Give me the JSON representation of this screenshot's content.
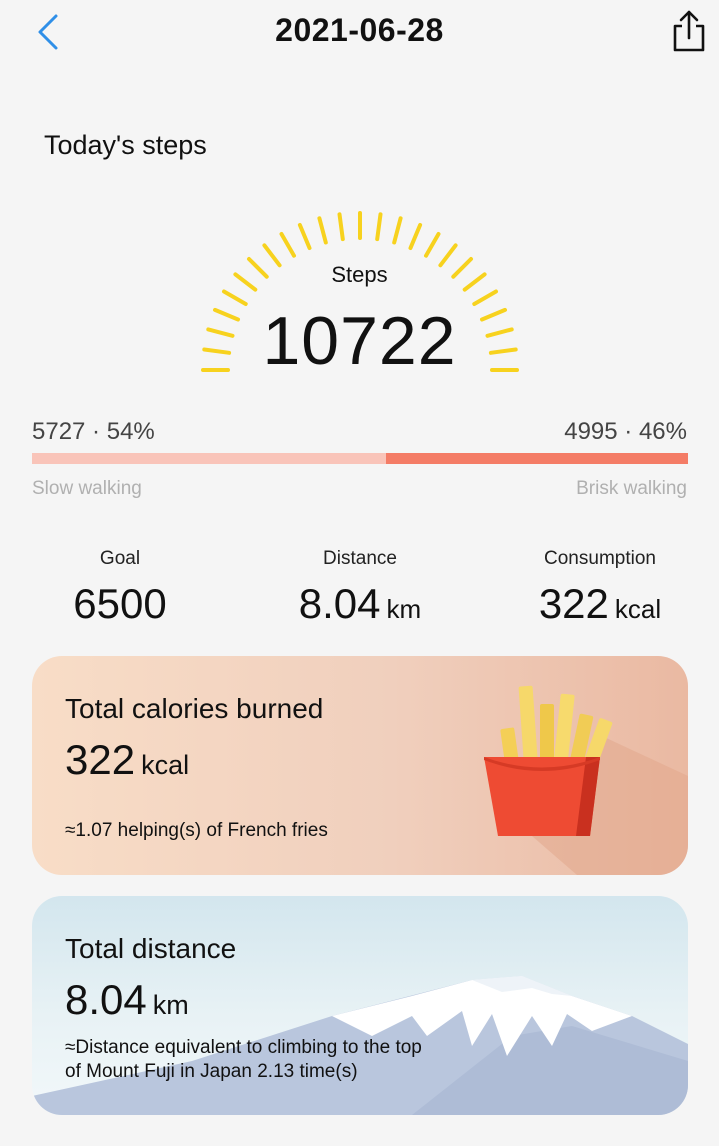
{
  "header": {
    "date": "2021-06-28",
    "back_icon": "chevron-left-icon",
    "share_icon": "share-icon"
  },
  "steps_section": {
    "title": "Today's steps",
    "label": "Steps",
    "value": "10722"
  },
  "walking_split": {
    "slow": {
      "text": "5727 · 54%",
      "label": "Slow walking",
      "fraction": 0.54,
      "color": "#f9c4b9"
    },
    "brisk": {
      "text": "4995 · 46%",
      "label": "Brisk walking",
      "fraction": 0.46,
      "color": "#f47c66"
    }
  },
  "stats": {
    "goal": {
      "label": "Goal",
      "value": "6500"
    },
    "distance": {
      "label": "Distance",
      "value": "8.04",
      "unit": "km"
    },
    "consumption": {
      "label": "Consumption",
      "value": "322",
      "unit": "kcal"
    }
  },
  "calories_card": {
    "title": "Total calories burned",
    "value": "322",
    "unit": "kcal",
    "note": "≈1.07 helping(s) of French fries",
    "illustration": "french-fries-icon"
  },
  "distance_card": {
    "title": "Total distance",
    "value": "8.04",
    "unit": "km",
    "note": "≈Distance equivalent to climbing to the top of Mount Fuji in Japan 2.13 time(s)",
    "illustration": "mount-fuji-illustration"
  },
  "colors": {
    "accent_blue": "#2f8fe8",
    "gauge_yellow": "#f7d21e"
  }
}
